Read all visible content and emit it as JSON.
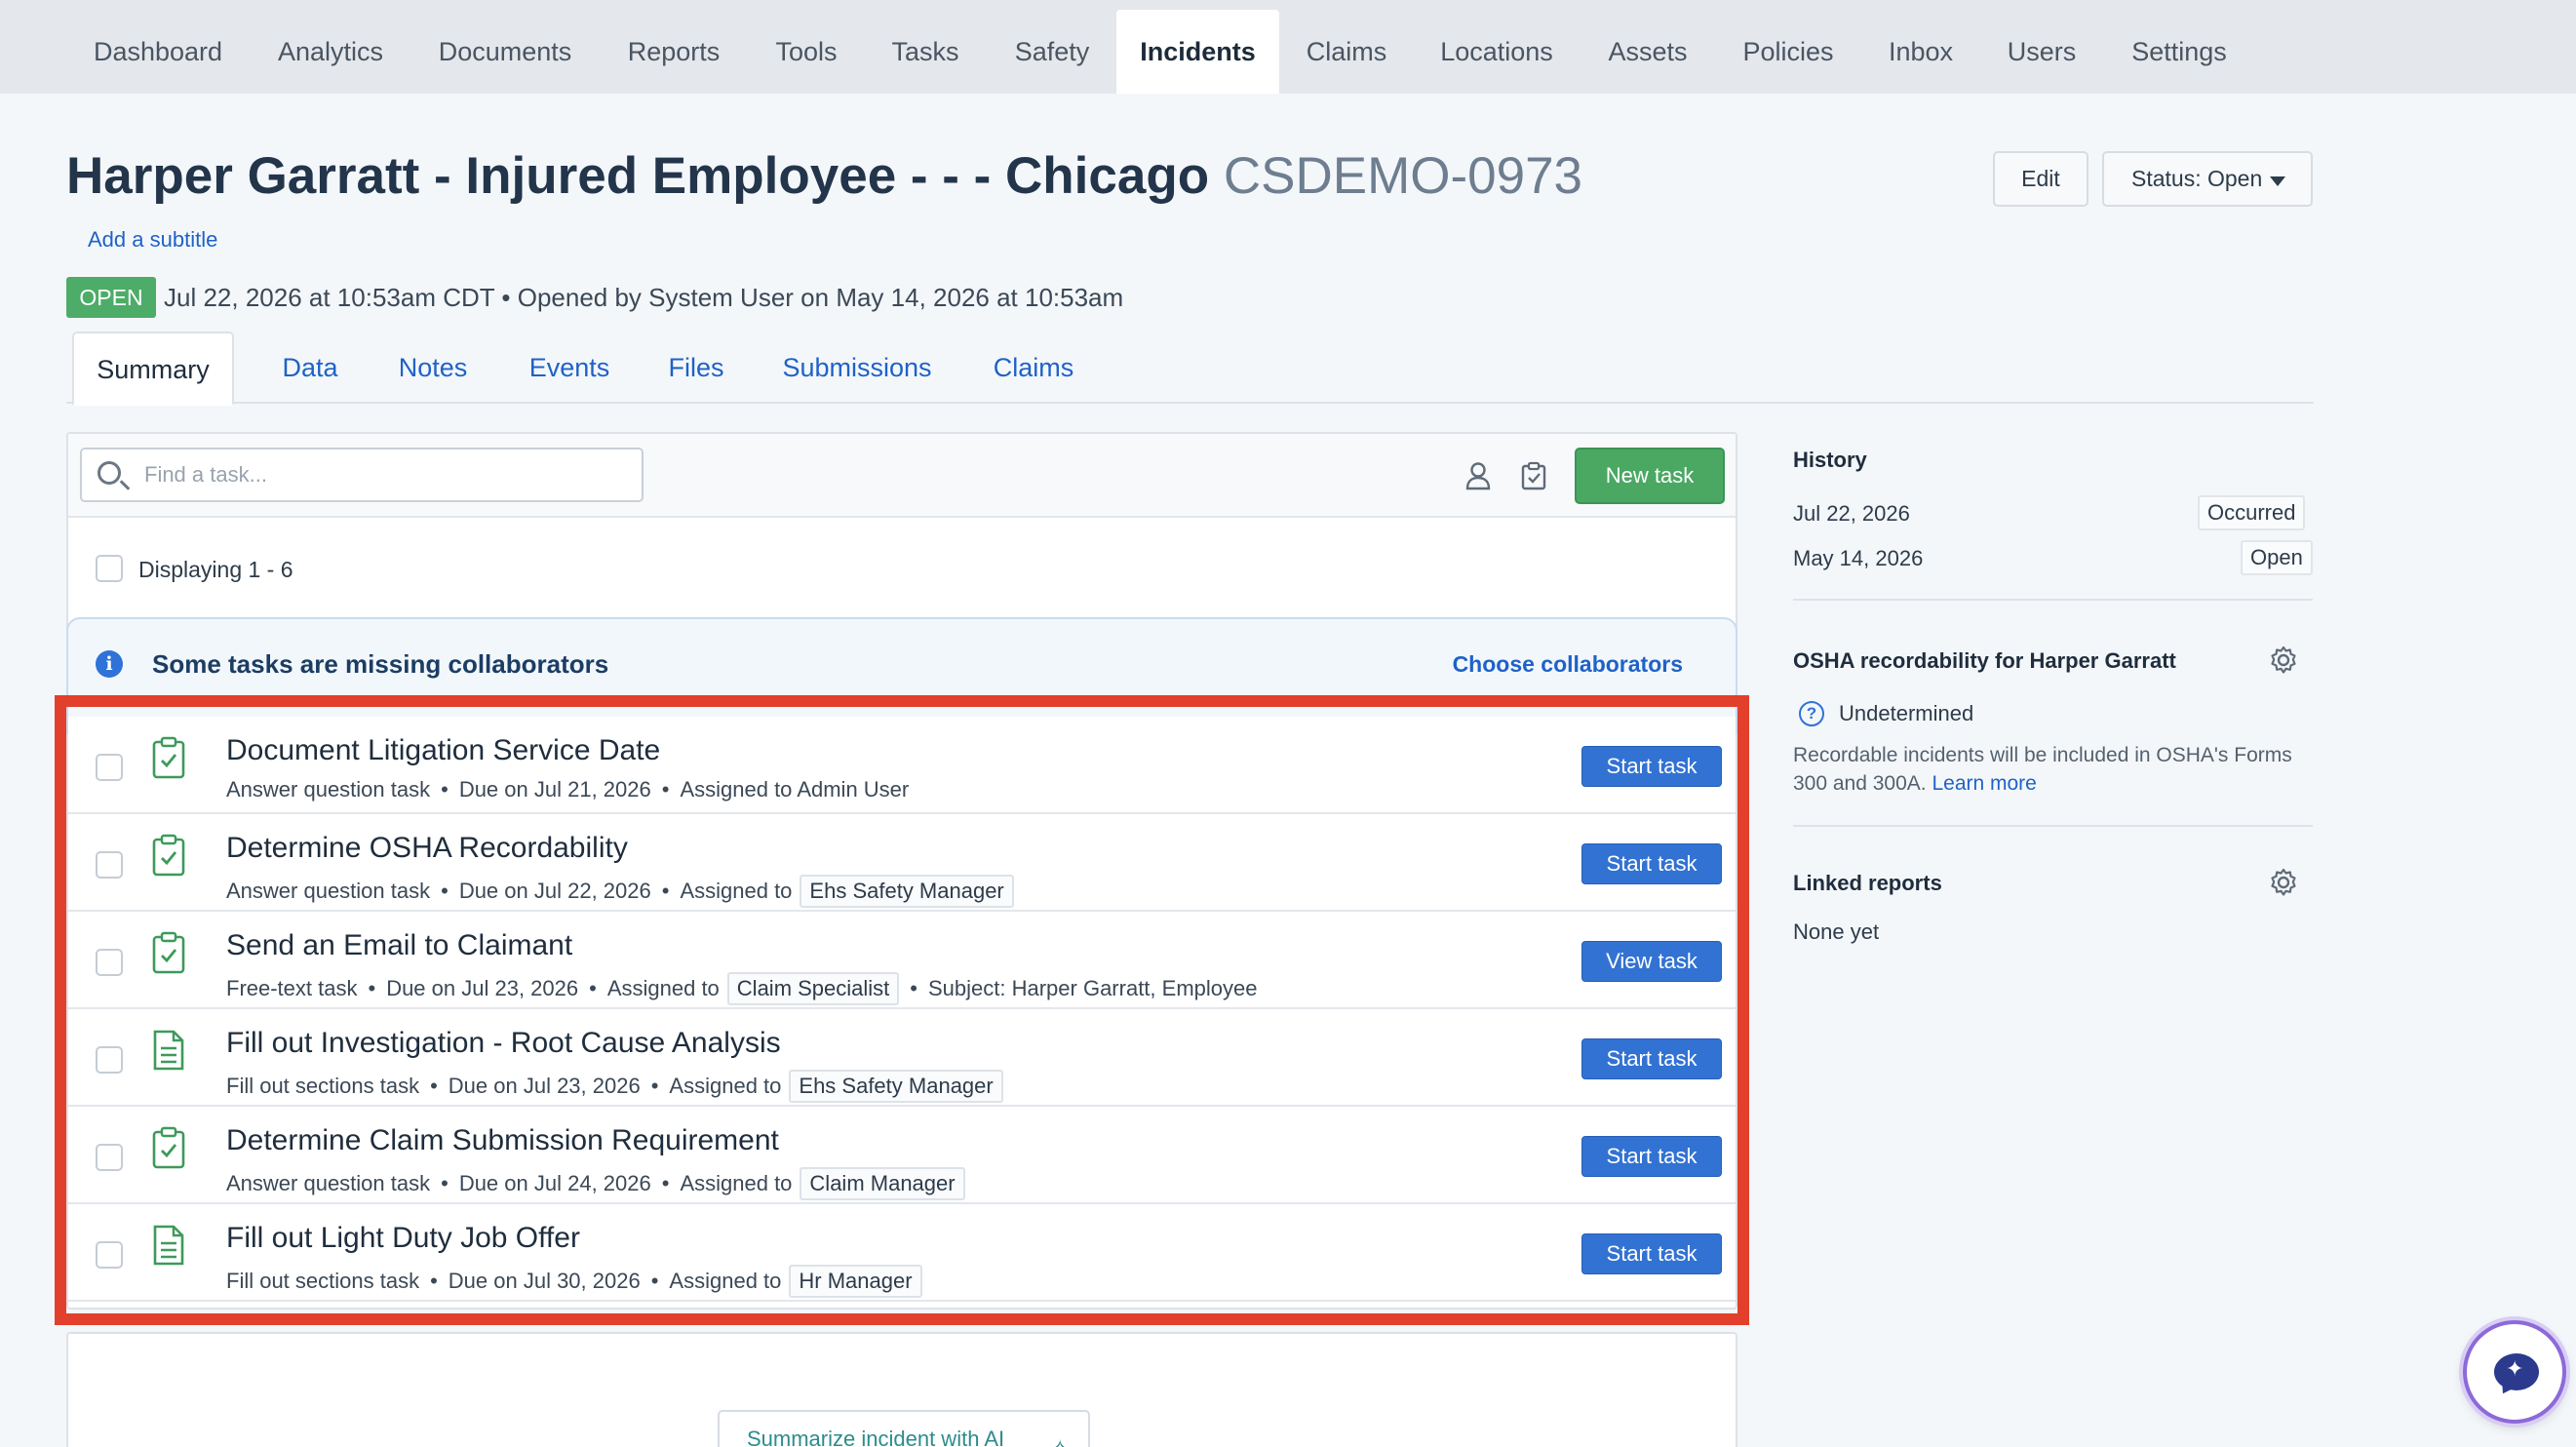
{
  "nav": {
    "tabs": [
      "Dashboard",
      "Analytics",
      "Documents",
      "Reports",
      "Tools",
      "Tasks",
      "Safety",
      "Incidents",
      "Claims",
      "Locations",
      "Assets",
      "Policies",
      "Inbox",
      "Users",
      "Settings"
    ],
    "active": "Incidents"
  },
  "header": {
    "title": "Harper Garratt - Injured Employee - - - Chicago",
    "code": "CSDEMO-0973",
    "subtitle_link": "Add a subtitle",
    "edit_label": "Edit",
    "status_label": "Status: Open",
    "badge": "OPEN",
    "meta": "Jul 22, 2026 at 10:53am CDT  •  Opened by System User on May 14, 2026 at 10:53am"
  },
  "subtabs": [
    "Summary",
    "Data",
    "Notes",
    "Events",
    "Files",
    "Submissions",
    "Claims"
  ],
  "tasks_panel": {
    "search_placeholder": "Find a task...",
    "new_task_label": "New task",
    "displaying": "Displaying 1 - 6",
    "alert_message": "Some tasks are missing collaborators",
    "alert_link": "Choose collaborators",
    "tasks": [
      {
        "name": "Document Litigation Service Date",
        "type": "Answer question task",
        "due": "Due on Jul 21, 2026",
        "assigned_prefix": "Assigned to Admin User",
        "assignee_chip": "",
        "extra": "",
        "button": "Start task",
        "icon": "clipboard-check-icon"
      },
      {
        "name": "Determine OSHA Recordability",
        "type": "Answer question task",
        "due": "Due on Jul 22, 2026",
        "assigned_prefix": "Assigned to",
        "assignee_chip": "Ehs Safety Manager",
        "extra": "",
        "button": "Start task",
        "icon": "clipboard-check-icon"
      },
      {
        "name": "Send an Email to Claimant",
        "type": "Free-text task",
        "due": "Due on Jul 23, 2026",
        "assigned_prefix": "Assigned to",
        "assignee_chip": "Claim Specialist",
        "extra": "Subject: Harper Garratt, Employee",
        "button": "View task",
        "icon": "clipboard-check-icon"
      },
      {
        "name": "Fill out Investigation - Root Cause Analysis",
        "type": "Fill out sections task",
        "due": "Due on Jul 23, 2026",
        "assigned_prefix": "Assigned to",
        "assignee_chip": "Ehs Safety Manager",
        "extra": "",
        "button": "Start task",
        "icon": "document-icon"
      },
      {
        "name": "Determine Claim Submission Requirement",
        "type": "Answer question task",
        "due": "Due on Jul 24, 2026",
        "assigned_prefix": "Assigned to",
        "assignee_chip": "Claim Manager",
        "extra": "",
        "button": "Start task",
        "icon": "clipboard-check-icon"
      },
      {
        "name": "Fill out Light Duty Job Offer",
        "type": "Fill out sections task",
        "due": "Due on Jul 30, 2026",
        "assigned_prefix": "Assigned to",
        "assignee_chip": "Hr Manager",
        "extra": "",
        "button": "Start task",
        "icon": "document-icon"
      }
    ]
  },
  "ai": {
    "button_label": "Summarize incident with AI"
  },
  "sidebar": {
    "history_title": "History",
    "history": [
      {
        "date": "Jul 22, 2026",
        "tag": "Occurred"
      },
      {
        "date": "May 14, 2026",
        "tag": "Open"
      }
    ],
    "osha_title": "OSHA recordability for Harper Garratt",
    "osha_status": "Undetermined",
    "osha_note": "Recordable incidents will be included in OSHA's Forms 300 and 300A.",
    "osha_learn_more": "Learn more",
    "linked_title": "Linked reports",
    "linked_empty": "None yet"
  },
  "colors": {
    "accent_blue": "#3272d2",
    "success_green": "#4aa863",
    "highlight_red": "#e2402c"
  }
}
